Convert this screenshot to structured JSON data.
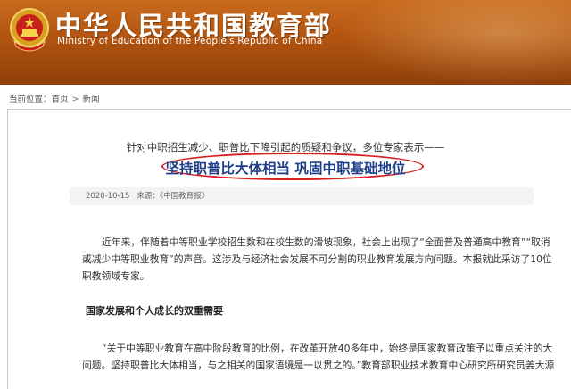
{
  "header": {
    "title": "中华人民共和国教育部",
    "subtitle": "Ministry of Education of the People's Republic of China",
    "bg_color": "#b25410"
  },
  "breadcrumb": {
    "label": "当前位置：",
    "items": [
      "首页",
      "新闻"
    ],
    "separator": ">"
  },
  "article": {
    "kicker": "针对中职招生减少、职普比下降引起的质疑和争议，多位专家表示——",
    "headline": "坚持职普比大体相当 巩固中职基础地位",
    "headline_color": "#1e3f8a",
    "highlight_color": "#d62020",
    "date": "2020-10-15",
    "source_label": "来源：《中国教育报》",
    "para1_lines": [
      "近年来，伴随着中等职业学校招生数和在校生数的滑坡现象，社会上出现了“全面普及普通高中教育”“取消",
      "或减少中等职业教育”的声音。这涉及与经济社会发展不可分割的职业教育发展方向问题。本报就此采访了10位",
      "职教领域专家。"
    ],
    "section_heading": "国家发展和个人成长的双重需要",
    "para2_lines": [
      "“关于中等职业教育在高中阶段教育的比例，在改革开放40多年中，始终是国家教育政策予以重点关注的大",
      "问题。坚持职普比大体相当，与之相关的国家语境是一以贯之的。”教育部职业技术教育中心研究所研究员姜大源"
    ]
  }
}
